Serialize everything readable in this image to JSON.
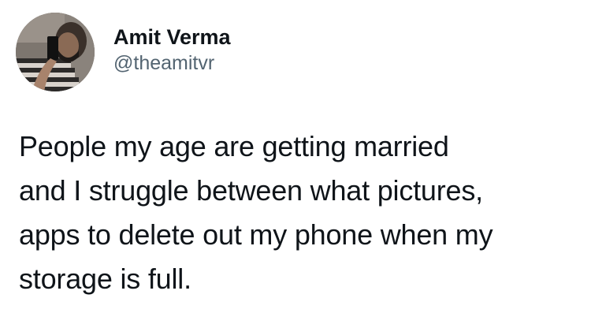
{
  "tweet": {
    "author": {
      "display_name": "Amit Verma",
      "handle": "@theamitvr"
    },
    "text_lines": [
      "People my age are getting married",
      "and I struggle between what pictures,",
      "apps to delete out my phone when my",
      "storage is full."
    ]
  },
  "colors": {
    "background": "#ffffff",
    "name": "#0f1419",
    "handle": "#536471",
    "text": "#0f1419"
  }
}
